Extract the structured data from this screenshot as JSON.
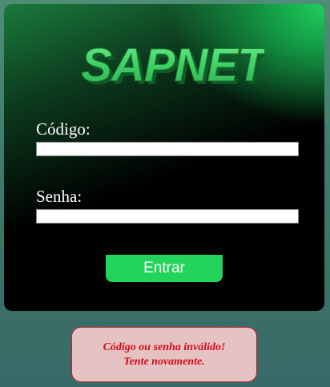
{
  "logo": {
    "text": "SAPNET",
    "icon": "sapnet-logo"
  },
  "form": {
    "code_label": "Código:",
    "code_value": "",
    "password_label": "Senha:",
    "password_value": "",
    "submit_label": "Entrar"
  },
  "error": {
    "line1": "Código ou senha inválido!",
    "line2": "Tente novamente."
  },
  "colors": {
    "accent_green": "#22d45a",
    "error_text": "#d60a1a",
    "error_background": "#e6c3c3"
  }
}
